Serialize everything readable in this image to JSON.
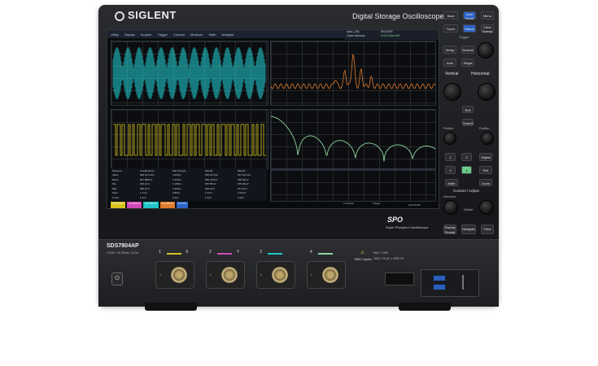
{
  "brand": "SIGLENT",
  "product_title": "Digital Storage Oscilloscope",
  "model": "SDS7804AP",
  "model_spec": "4 GHz / 20 GSa/s / 12-bit",
  "spo_logo": "SPO",
  "spo_subtitle": "Super Phosphor Oscilloscope",
  "screen": {
    "menu": [
      "Utility",
      "Display",
      "Acquire",
      "Trigger",
      "Cursors",
      "Measure",
      "Math",
      "Analysis"
    ],
    "status": {
      "line1": "Auto (-28)",
      "line2": "Claim Memory",
      "line3": "SIGLENT",
      "line4": "5.00 GSa/s 5M"
    },
    "table_header": [
      "Measure",
      "Amplitude(1)",
      "Max.Freq(1)",
      "Max(2)",
      "Max(3)"
    ],
    "table_rows": [
      [
        "Value",
        "998.3mV/ch4",
        "3.420ns",
        "999.3mV/ch",
        "207.3mV/ch"
      ],
      [
        "Mean",
        "997.889mV",
        "3.420ns",
        "955.479mV",
        "206.46mV"
      ],
      [
        "Min",
        "993.3mV",
        "1.180ns",
        "995.55mV",
        "205.32mV"
      ],
      [
        "Max",
        "999.3mV",
        "3.420ns",
        "999.3mV",
        "207.3mV"
      ],
      [
        "Sdev",
        "1.7mV",
        "0.88ns",
        "1.4mV",
        "0.34mV"
      ],
      [
        "Count",
        "1.0e4",
        "1.0e4",
        "1.0e4",
        "1.0e4"
      ]
    ],
    "channel_tabs": [
      {
        "label": "C1 200mV",
        "color": "#d8c21c"
      },
      {
        "label": "C2 200mV",
        "color": "#d049b8"
      },
      {
        "label": "C3 200mV",
        "color": "#20c5c8"
      },
      {
        "label": "C4 200mV",
        "color": "#e07a2c"
      },
      {
        "label": "Z1 5mV",
        "color": "#2d64c6"
      }
    ],
    "timebase": "Timebase",
    "trigger": "Trigger",
    "date": "2024/11/25"
  },
  "buttons": {
    "save": "Save",
    "autoscale": "Auto Scale",
    "single_menu": "Menu",
    "touch": "Touch",
    "history": "History",
    "clear_sweep": "Clear Sweep",
    "trigger_section": "Trigger",
    "setup": "Setup",
    "nxt": "Normal",
    "auto": "Auto",
    "single": "Single",
    "vertical": "Vertical",
    "horizontal": "Horizontal",
    "roll": "Roll",
    "search": "Search",
    "position_v": "Position",
    "position_h": "Position",
    "ch1": "1",
    "ch2": "2",
    "digital": "Digital",
    "ch3": "3",
    "ch4": "4",
    "ref": "Ref",
    "math": "Math",
    "zoom": "Zoom",
    "cursors_adjust": "Cursors / Adjust",
    "universal": "Universal",
    "push_default": "Default",
    "display_persist": "Display Persist",
    "navigate": "Navigate",
    "clear": "Clear"
  },
  "frontpanel": {
    "channel_labels": [
      "1",
      "2",
      "3",
      "4"
    ],
    "channel_colors": [
      "#d8c21c",
      "#d049b8",
      "#20c5c8",
      "#8fd6a0"
    ],
    "x_label": "X",
    "y_label": "Y",
    "bnc_inputs": "BNC Inputs",
    "bnc_spec1": "50Ω / 1 MΩ",
    "bnc_spec2": "1MΩ // 15 pF  ≤ 400V Pk"
  }
}
